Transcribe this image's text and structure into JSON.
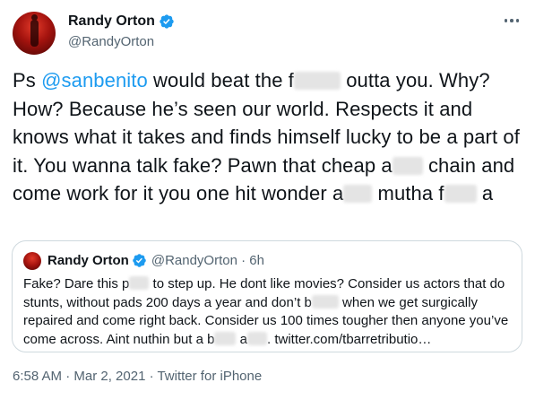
{
  "author": {
    "name": "Randy Orton",
    "handle": "@RandyOrton"
  },
  "tweet": {
    "t1": "Ps ",
    "mention": "@sanbenito",
    "t2": " would beat the f",
    "t3": " outta you. Why? How? Because he’s seen our world. Respects it and knows what it takes and finds himself lucky to be a part of it. You wanna talk fake? Pawn that cheap a",
    "t4": " chain and come work for it you one hit wonder a",
    "t5": " mutha f",
    "t6": " a"
  },
  "quote": {
    "name": "Randy Orton",
    "meta": "@RandyOrton · 6h",
    "q1": "Fake? Dare this p",
    "q2": " to step up. He dont like movies? Consider us actors that do stunts, without pads 200 days a year and don’t b",
    "q3": " when we get surgically repaired and come right back. Consider us 100 times tougher then anyone you’ve come across. Aint nuthin but a b",
    "q4": " a",
    "q5": ". twitter.com/tbarretributio…"
  },
  "footer": {
    "meta": "6:58 AM · Mar 2, 2021 · Twitter for iPhone"
  },
  "colors": {
    "link": "#1d9bf0",
    "secondary_text": "#536471",
    "border": "#cfd9de"
  },
  "icons": {
    "verified": "verified-badge-icon",
    "more": "more-options-icon"
  }
}
